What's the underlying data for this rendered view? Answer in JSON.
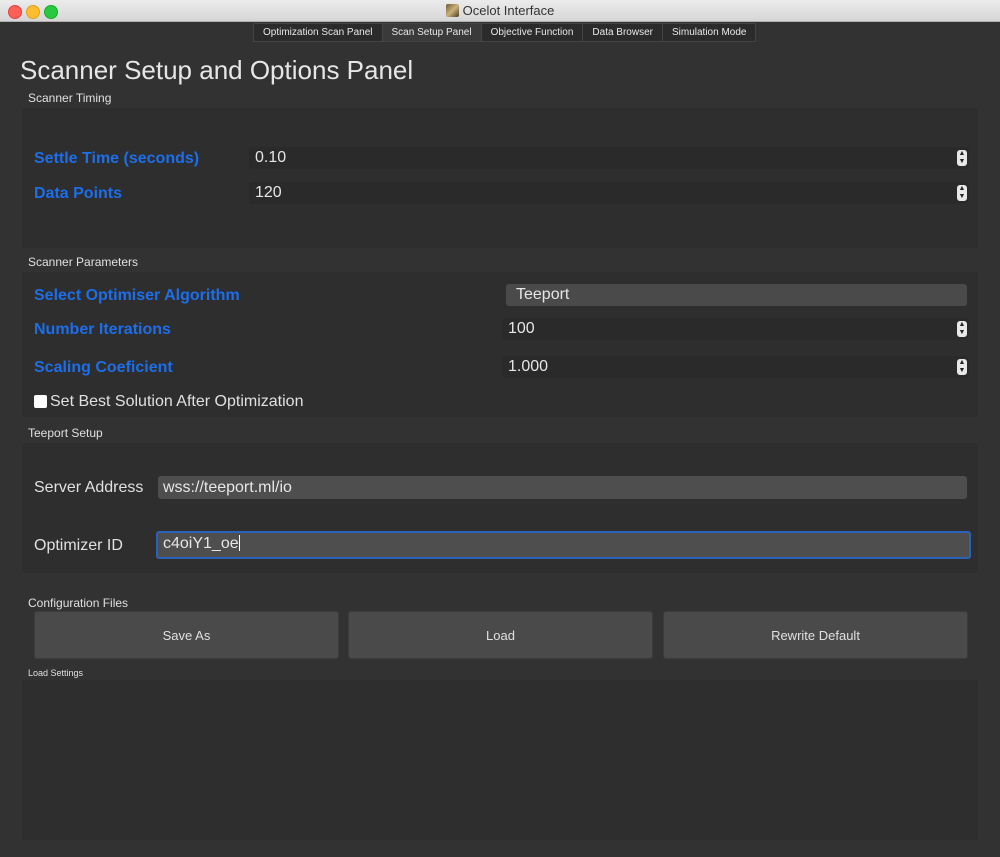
{
  "window": {
    "title": "Ocelot Interface"
  },
  "tabs": [
    {
      "label": "Optimization Scan Panel"
    },
    {
      "label": "Scan Setup Panel"
    },
    {
      "label": "Objective Function"
    },
    {
      "label": "Data Browser"
    },
    {
      "label": "Simulation Mode"
    }
  ],
  "page_title": "Scanner Setup and Options Panel",
  "scanner_timing": {
    "group_label": "Scanner Timing",
    "settle_time_label": "Settle Time (seconds)",
    "settle_time_value": "0.10",
    "data_points_label": "Data Points",
    "data_points_value": "120"
  },
  "scanner_parameters": {
    "group_label": "Scanner Parameters",
    "algorithm_label": "Select Optimiser Algorithm",
    "algorithm_value": "Teeport",
    "iterations_label": "Number Iterations",
    "iterations_value": "100",
    "scaling_label": "Scaling Coeficient",
    "scaling_value": "1.000",
    "best_solution_label": "Set Best Solution After Optimization",
    "best_solution_checked": false
  },
  "teeport_setup": {
    "group_label": "Teeport Setup",
    "server_label": "Server Address",
    "server_value": "wss://teeport.ml/io",
    "optimizer_label": "Optimizer ID",
    "optimizer_value": "c4oiY1_oe"
  },
  "config_files": {
    "group_label": "Configuration Files",
    "save_as": "Save As",
    "load": "Load",
    "rewrite_default": "Rewrite Default"
  },
  "load_settings": {
    "group_label": "Load Settings"
  },
  "colors": {
    "accent_blue": "#1d6ee8",
    "background": "#323232",
    "focus_border": "#2a62b7"
  }
}
